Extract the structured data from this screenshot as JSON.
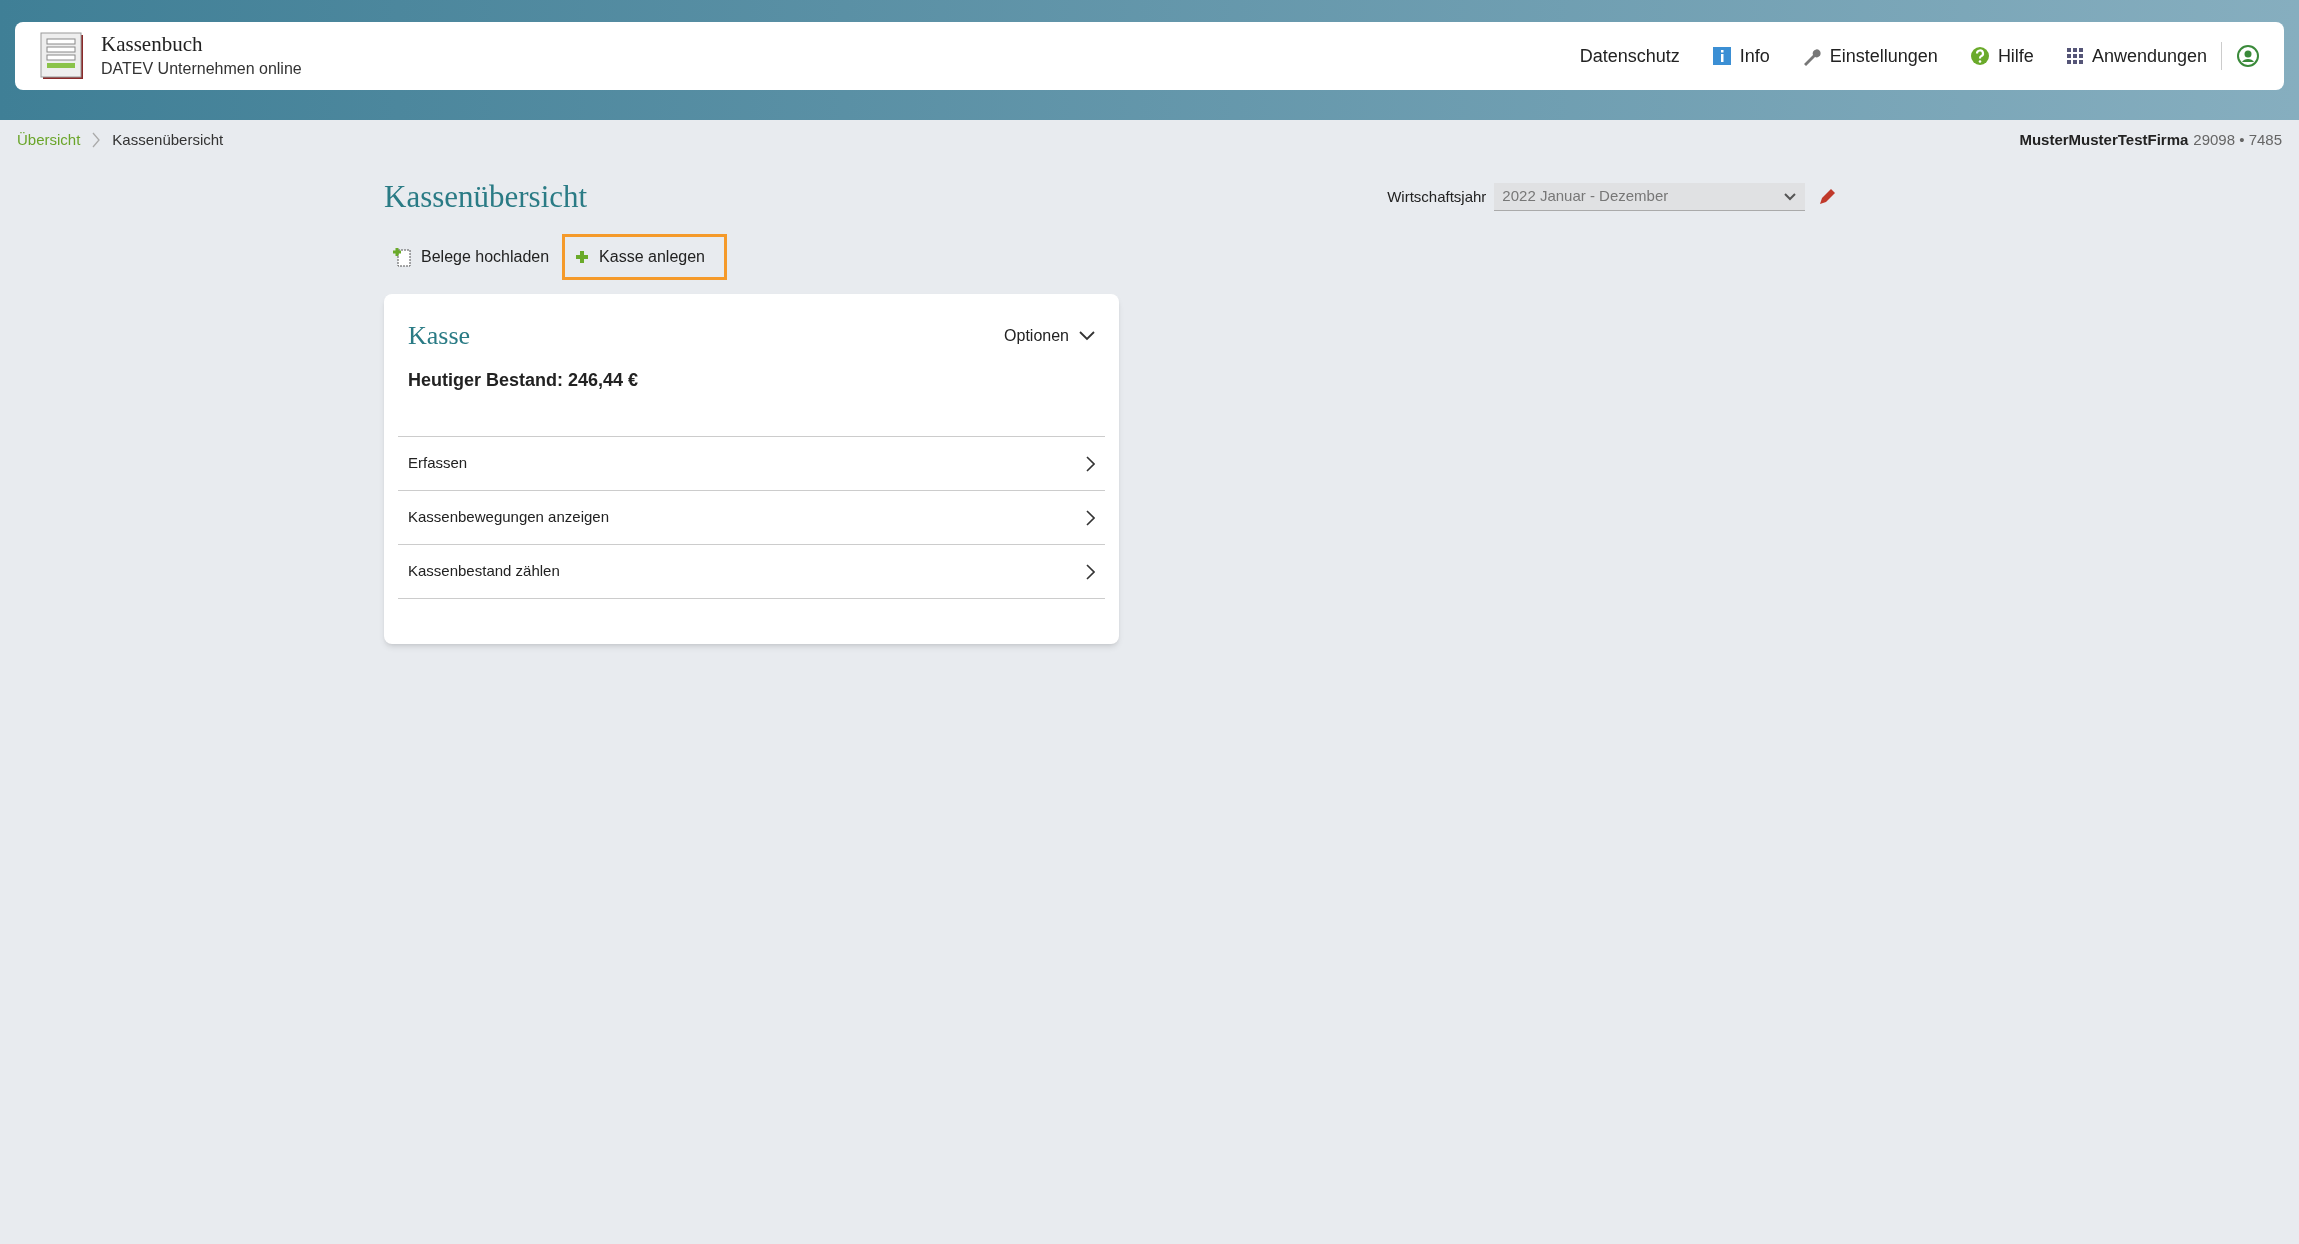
{
  "app": {
    "title": "Kassenbuch",
    "subtitle": "DATEV Unternehmen online"
  },
  "nav": [
    {
      "label": "Datenschutz",
      "kind": "text"
    },
    {
      "label": "Info",
      "kind": "info"
    },
    {
      "label": "Einstellungen",
      "kind": "wrench"
    },
    {
      "label": "Hilfe",
      "kind": "help"
    },
    {
      "label": "Anwendungen",
      "kind": "grid"
    }
  ],
  "breadcrumb": [
    {
      "label": "Übersicht",
      "current": false
    },
    {
      "label": "Kassenübersicht",
      "current": true
    }
  ],
  "company": {
    "name": "MusterMusterTestFirma",
    "number": "29098 • 7485"
  },
  "page_title": "Kassenübersicht",
  "fiscal_year": {
    "label": "Wirtschaftsjahr",
    "value": "2022 Januar - Dezember"
  },
  "actions": [
    {
      "label": "Belege hochladen",
      "kind": "upload",
      "focused": false
    },
    {
      "label": "Kasse anlegen",
      "kind": "add",
      "focused": true
    }
  ],
  "card": {
    "title": "Kasse",
    "options": "Optionen",
    "balance": "Heutiger Bestand: 246,44 €",
    "items": [
      {
        "label": "Erfassen"
      },
      {
        "label": "Kassenbewegungen anzeigen"
      },
      {
        "label": "Kassenbestand zählen"
      }
    ]
  }
}
